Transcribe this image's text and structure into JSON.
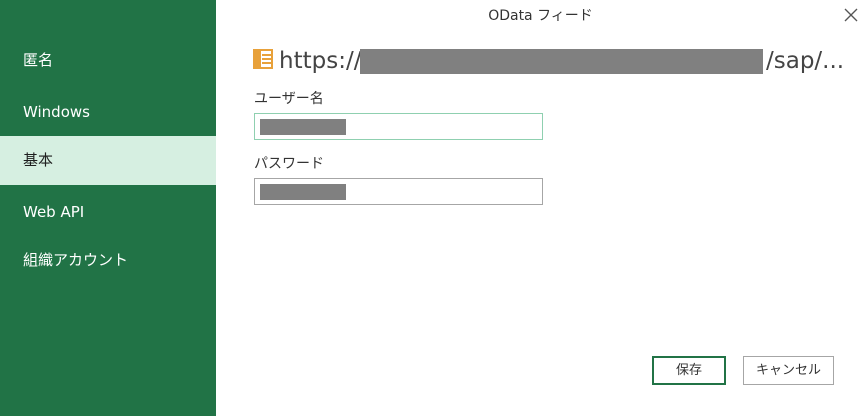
{
  "window": {
    "title": "OData フィード"
  },
  "sidebar": {
    "items": [
      {
        "label": "匿名",
        "selected": false
      },
      {
        "label": "Windows",
        "selected": false
      },
      {
        "label": "基本",
        "selected": true
      },
      {
        "label": "Web API",
        "selected": false
      },
      {
        "label": "組織アカウント",
        "selected": false
      }
    ]
  },
  "source": {
    "url_prefix": "https://",
    "url_suffix": "/sap/...",
    "icon": "odata-feed-icon",
    "url_redacted": true
  },
  "form": {
    "username_label": "ユーザー名",
    "username_redacted": true,
    "password_label": "パスワード",
    "password_redacted": true
  },
  "buttons": {
    "save_label": "保存",
    "cancel_label": "キャンセル"
  },
  "colors": {
    "sidebar_bg": "#217346",
    "selected_item_bg": "#d6efe1",
    "icon_accent": "#e8a13a",
    "redaction": "#808080"
  }
}
